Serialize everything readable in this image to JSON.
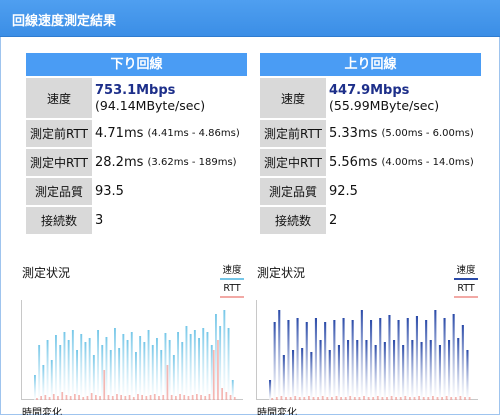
{
  "header": {
    "title": "回線速度測定結果"
  },
  "colors": {
    "header_bg": "#3b8ee6",
    "panel_title_bg": "#4a9cf4",
    "label_bg": "#d9d9d9",
    "down_speed": "#76c7e8",
    "down_rtt": "#f2a9a5",
    "up_speed": "#2a4aa8",
    "up_rtt": "#f2a9a5"
  },
  "down": {
    "title": "下り回線",
    "speed_label": "速度",
    "speed_main": "753.1Mbps",
    "speed_sub": "(94.14MByte/sec)",
    "rtt_before_label": "測定前RTT",
    "rtt_before_value": "4.71ms",
    "rtt_before_range": "(4.41ms - 4.86ms)",
    "rtt_during_label": "測定中RTT",
    "rtt_during_value": "28.2ms",
    "rtt_during_range": "(3.62ms - 189ms)",
    "quality_label": "測定品質",
    "quality_value": "93.5",
    "connections_label": "接続数",
    "connections_value": "3",
    "status_title": "測定状況",
    "legend_speed": "速度",
    "legend_rtt": "RTT",
    "time_label": "時間変化"
  },
  "up": {
    "title": "上り回線",
    "speed_label": "速度",
    "speed_main": "447.9Mbps",
    "speed_sub": "(55.99MByte/sec)",
    "rtt_before_label": "測定前RTT",
    "rtt_before_value": "5.33ms",
    "rtt_before_range": "(5.00ms - 6.00ms)",
    "rtt_during_label": "測定中RTT",
    "rtt_during_value": "5.56ms",
    "rtt_during_range": "(4.00ms - 14.0ms)",
    "quality_label": "測定品質",
    "quality_value": "92.5",
    "connections_label": "接続数",
    "connections_value": "2",
    "status_title": "測定状況",
    "legend_speed": "速度",
    "legend_rtt": "RTT",
    "time_label": "時間変化"
  },
  "chart_data": [
    {
      "type": "bar",
      "name": "down",
      "series": [
        {
          "name": "速度",
          "values": [
            0.25,
            0.55,
            0.35,
            0.6,
            0.4,
            0.65,
            0.55,
            0.68,
            0.6,
            0.7,
            0.5,
            0.66,
            0.58,
            0.62,
            0.45,
            0.7,
            0.55,
            0.63,
            0.5,
            0.72,
            0.52,
            0.66,
            0.6,
            0.68,
            0.48,
            0.64,
            0.58,
            0.7,
            0.55,
            0.62,
            0.5,
            0.67,
            0.6,
            0.45,
            0.68,
            0.58,
            0.74,
            0.66,
            0.7,
            0.62,
            0.72,
            0.68,
            0.55,
            0.86,
            0.74,
            0.9,
            0.72,
            0.2
          ]
        },
        {
          "name": "RTT",
          "values": [
            0.02,
            0.04,
            0.05,
            0.03,
            0.06,
            0.04,
            0.08,
            0.05,
            0.04,
            0.06,
            0.05,
            0.03,
            0.04,
            0.07,
            0.05,
            0.04,
            0.3,
            0.05,
            0.04,
            0.06,
            0.05,
            0.04,
            0.05,
            0.03,
            0.06,
            0.05,
            0.04,
            0.05,
            0.06,
            0.04,
            0.05,
            0.35,
            0.05,
            0.04,
            0.06,
            0.05,
            0.04,
            0.05,
            0.06,
            0.05,
            0.04,
            0.06,
            0.5,
            0.6,
            0.12,
            0.08,
            0.05,
            0.03
          ]
        }
      ]
    },
    {
      "type": "bar",
      "name": "up",
      "series": [
        {
          "name": "速度",
          "values": [
            0.2,
            0.78,
            0.9,
            0.45,
            0.8,
            0.5,
            0.82,
            0.52,
            0.78,
            0.48,
            0.82,
            0.6,
            0.78,
            0.5,
            0.8,
            0.55,
            0.82,
            0.6,
            0.8,
            0.6,
            0.9,
            0.6,
            0.8,
            0.55,
            0.82,
            0.58,
            0.85,
            0.6,
            0.8,
            0.55,
            0.82,
            0.6,
            0.84,
            0.58,
            0.8,
            0.6,
            0.9,
            0.55,
            0.82,
            0.6,
            0.86,
            0.62,
            0.75,
            0.5
          ]
        },
        {
          "name": "RTT",
          "values": [
            0.02,
            0.03,
            0.04,
            0.03,
            0.03,
            0.04,
            0.03,
            0.03,
            0.04,
            0.03,
            0.03,
            0.04,
            0.03,
            0.03,
            0.04,
            0.03,
            0.03,
            0.04,
            0.03,
            0.03,
            0.04,
            0.03,
            0.03,
            0.04,
            0.03,
            0.03,
            0.04,
            0.03,
            0.03,
            0.04,
            0.03,
            0.03,
            0.04,
            0.03,
            0.03,
            0.04,
            0.03,
            0.03,
            0.04,
            0.03,
            0.03,
            0.04,
            0.03,
            0.03
          ]
        }
      ]
    }
  ]
}
